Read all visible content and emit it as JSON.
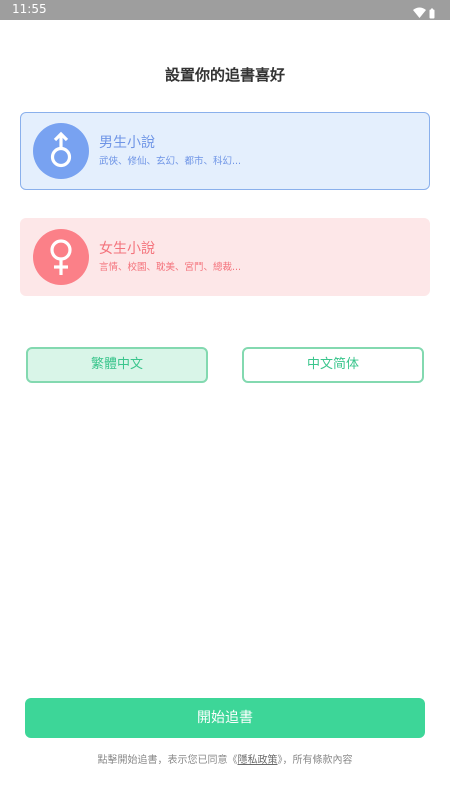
{
  "status_bar": {
    "time": "11:55",
    "icons": [
      "wifi-icon",
      "battery-icon"
    ]
  },
  "page": {
    "title": "設置你的追書喜好"
  },
  "genres": [
    {
      "title": "男生小說",
      "subtitle": "武俠、修仙、玄幻、都市、科幻...",
      "icon": "male-symbol-icon",
      "selected": true,
      "color": "#78a2f1"
    },
    {
      "title": "女生小說",
      "subtitle": "言情、校園、耽美、宮鬥、總裁...",
      "icon": "female-symbol-icon",
      "selected": false,
      "color": "#fb8088"
    }
  ],
  "language": {
    "options": [
      "繁體中文",
      "中文简体"
    ],
    "selected": "繁體中文"
  },
  "start_button": {
    "label": "開始追書"
  },
  "footer": {
    "prefix": "點擊開始追書，表示您已同意《",
    "link": "隱私政策",
    "suffix": "》，所有條款內容"
  },
  "colors": {
    "accent": "#3dd698",
    "male": "#78a2f1",
    "female": "#fb8088"
  }
}
